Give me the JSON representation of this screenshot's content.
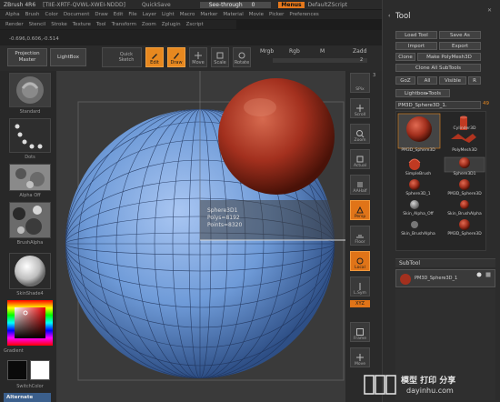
{
  "titlebar": {
    "app_title": "ZBrush 4R6",
    "doc_info": "[TIIE-XRTF-QVWL-XWEI-NDDD]",
    "quicksave": "QuickSave",
    "seethrough": "See-through",
    "seethrough_value": "0",
    "menus": "Menus",
    "default_script": "DefaultZScript"
  },
  "menubar": {
    "row1": [
      "Alpha",
      "Brush",
      "Color",
      "Document",
      "Draw",
      "Edit",
      "File",
      "Layer",
      "Light",
      "Macro",
      "Marker",
      "Material",
      "Movie",
      "Picker",
      "Preferences"
    ],
    "row2": [
      "Render",
      "Stencil",
      "Stroke",
      "Texture",
      "Tool",
      "Transform",
      "Zoom",
      "Zplugin",
      "Zscript"
    ]
  },
  "coords": "-0.696,0.606,-0.514",
  "toolbar": {
    "projection_master": "Projection Master",
    "lightbox": "LightBox",
    "quick_sketch": "Quick Sketch",
    "edit": "Edit",
    "draw": "Draw",
    "move": "Move",
    "scale": "Scale",
    "rotate": "Rotate",
    "mrgb": "Mrgb",
    "rgb": "Rgb",
    "m": "M",
    "zadd": "Zadd",
    "zadd_value": "2"
  },
  "leftshelf": {
    "standard": "Standard",
    "dots": "Dots",
    "alpha_off": "Alpha Off",
    "brushalpha": "BrushAlpha",
    "texture_off": "Texture Off",
    "skinshade": "SkinShade4",
    "gradient": "Gradient",
    "switchcolor": "SwitchColor",
    "alternate": "Alternate"
  },
  "info_popup": {
    "name": "Sphere3D1",
    "polys": "Polys=8192",
    "points": "Points=8320"
  },
  "rightshelf": {
    "spix": "SPix",
    "spix_value": "3",
    "scroll": "Scroll",
    "zoom": "Zoom",
    "actual": "Actual",
    "aahalf": "AAHalf",
    "persp": "Persp",
    "floor": "Floor",
    "local": "Local",
    "lsym": "L.Sym",
    "xyz": "XYZ",
    "frame": "Frame",
    "move": "Move"
  },
  "toolpanel": {
    "title": "Tool",
    "load_tool": "Load Tool",
    "save_as": "Save As",
    "import": "Import",
    "export": "Export",
    "clone": "Clone",
    "make_polymesh": "Make PolyMesh3D",
    "clone_all_subtools": "Clone All SubTools",
    "goz": "GoZ",
    "all": "All",
    "visible": "Visible",
    "r": "R",
    "lightbox_tools": "Lightbox▸Tools",
    "current_tool": "PM3D_Sphere3D_1.",
    "current_tool_count": "49",
    "items": [
      "PM3D_Sphere3D",
      "Cylinder3D",
      "PolyMesh3D",
      "SimpleBrush",
      "Sphere3D1",
      "Sphere3D_1",
      "PM3D_Sphere3D",
      "Skin_Alpha_Off",
      "Skin_BrushAlpha",
      "Skin_BrushAlpha",
      "PM3D_Sphere3D"
    ],
    "subtool": "SubTool",
    "subtool_item": "PM3D_Sphere3D_1"
  },
  "watermark": {
    "logo": "打印虎",
    "line1": "模型 打印 分享",
    "line2": "dayinhu.com"
  },
  "colors": {
    "accent": "#e7881f",
    "mesh_blue": "#6f9bd8",
    "sphere_red": "#a3301e"
  }
}
